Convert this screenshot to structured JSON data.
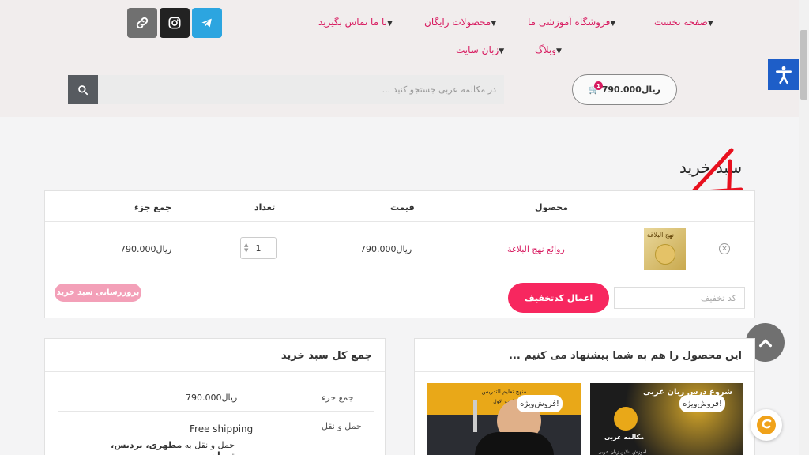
{
  "nav": {
    "items": [
      "صفحه نخست",
      "فروشگاه آموزشی ما",
      "محصولات رایگان",
      "با ما تماس بگیرید",
      "وبلاگ",
      "زبان سایت"
    ]
  },
  "social": {
    "icons": [
      "link-icon",
      "instagram-icon",
      "telegram-icon"
    ],
    "colors": {
      "link": "#707070",
      "instagram": "#222222",
      "telegram": "#2ca5e0"
    }
  },
  "header": {
    "cart_total": "ریال790.000",
    "cart_count": "1",
    "search_placeholder": "در مکالمه عربی جستجو کنید ..."
  },
  "page": {
    "title": "سبد خرید",
    "annotation": "4"
  },
  "cart": {
    "headers": {
      "product": "محصول",
      "price": "قیمت",
      "quantity": "تعداد",
      "subtotal": "جمع جزء"
    },
    "row": {
      "thumb_text": "نهج البلاغة",
      "name": "روائع نهج البلاغة",
      "price": "ریال790.000",
      "quantity": "1",
      "subtotal": "ریال790.000"
    },
    "coupon_placeholder": "کد تخفیف",
    "apply_label": "اعمال کدتخفیف",
    "update_label": "بروزرسانی سبد خرید"
  },
  "totals": {
    "title": "جمع کل سبد خرید",
    "subtotal_label": "جمع جزء",
    "subtotal_value": "ریال790.000",
    "shipping_label": "حمل و نقل",
    "shipping_value": "Free shipping",
    "shipping_to_prefix": "حمل و نقل به",
    "shipping_to_place": "مطهری، بردیس، تهران،"
  },
  "suggest": {
    "title": "این محصول را هم به شما پیشنهاد می کنیم ...",
    "badge_label": "فروش‌ویژه!",
    "product_left_lines": [
      "منهج تعلیم التدریس",
      "الحب الاول"
    ],
    "product_right_lines": [
      "شروع درس زبان عربی",
      "مکالمه عربی",
      "آموزش آنلاین زبان عربی"
    ]
  },
  "colors": {
    "accent": "#d81b60",
    "button": "#f7275f",
    "annotation": "#e8101e",
    "accessibility": "#1e5ec8"
  }
}
